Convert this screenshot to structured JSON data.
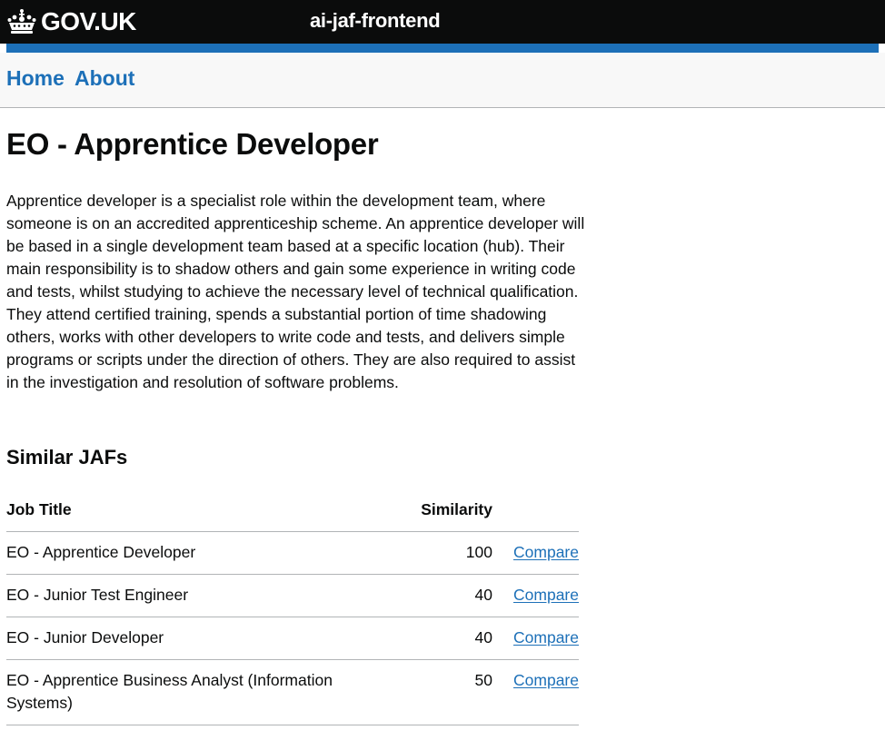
{
  "header": {
    "brand": "GOV.UK",
    "service_name": "ai-jaf-frontend"
  },
  "nav": {
    "items": [
      {
        "label": "Home"
      },
      {
        "label": "About"
      }
    ]
  },
  "main": {
    "title": "EO - Apprentice Developer",
    "description": "Apprentice developer is a specialist role within the development team, where someone is on an accredited apprenticeship scheme. An apprentice developer will be based in a single development team based at a specific location (hub). Their main responsibility is to shadow others and gain some experience in writing code and tests, whilst studying to achieve the necessary level of technical qualification. They attend certified training, spends a substantial portion of time shadowing others, works with other developers to write code and tests, and delivers simple programs or scripts under the direction of others. They are also required to assist in the investigation and resolution of software problems.",
    "similar_title": "Similar JAFs",
    "table": {
      "headers": {
        "job_title": "Job Title",
        "similarity": "Similarity"
      },
      "rows": [
        {
          "job_title": "EO - Apprentice Developer",
          "similarity": "100",
          "action": "Compare"
        },
        {
          "job_title": "EO - Junior Test Engineer",
          "similarity": "40",
          "action": "Compare"
        },
        {
          "job_title": "EO - Junior Developer",
          "similarity": "40",
          "action": "Compare"
        },
        {
          "job_title": "EO - Apprentice Business Analyst (Information Systems)",
          "similarity": "50",
          "action": "Compare"
        }
      ]
    }
  },
  "colors": {
    "header_bg": "#0b0c0c",
    "accent": "#1d70b8",
    "nav_bg": "#f8f8f8",
    "border": "#b1b4b6"
  },
  "icons": {
    "brand_logo": "crown-icon"
  }
}
